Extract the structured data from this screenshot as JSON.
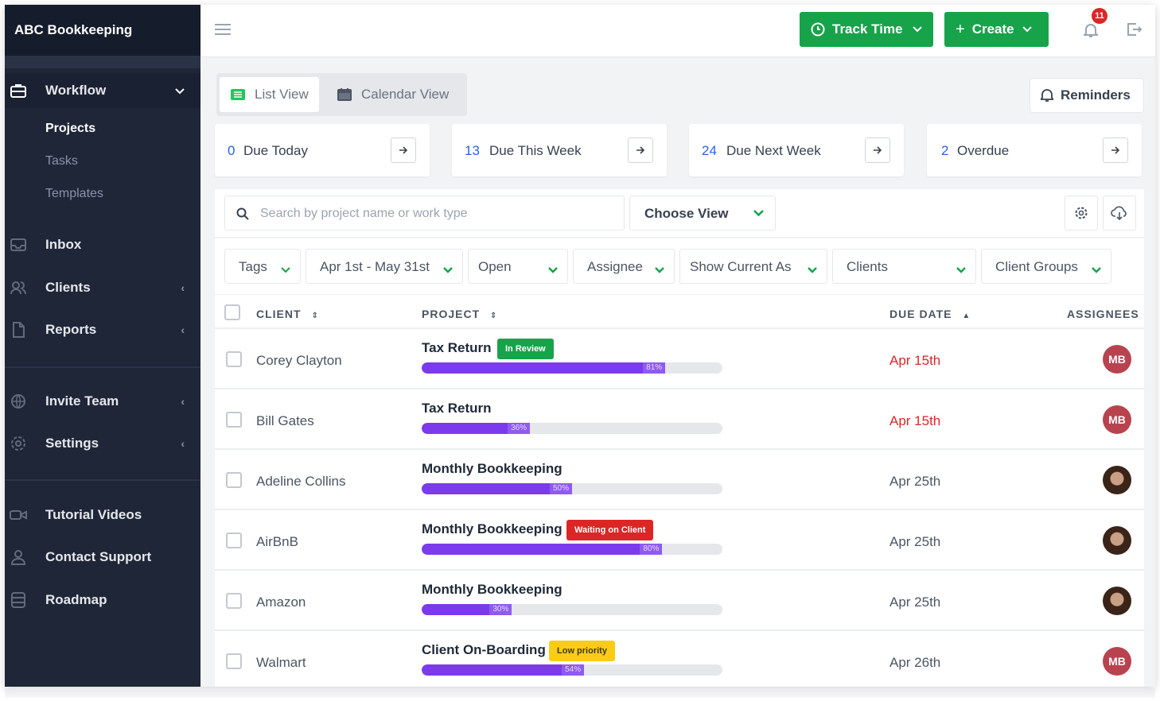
{
  "app": {
    "title": "ABC Bookkeeping"
  },
  "sidebar": {
    "workflow": "Workflow",
    "sub": [
      "Projects",
      "Tasks",
      "Templates"
    ],
    "items": [
      {
        "label": "Inbox",
        "icon": "inbox-icon"
      },
      {
        "label": "Clients",
        "icon": "users-icon"
      },
      {
        "label": "Reports",
        "icon": "document-icon"
      },
      {
        "label": "Invite Team",
        "icon": "globe-icon"
      },
      {
        "label": "Settings",
        "icon": "gear-icon"
      },
      {
        "label": "Tutorial Videos",
        "icon": "video-icon"
      },
      {
        "label": "Contact Support",
        "icon": "person-icon"
      },
      {
        "label": "Roadmap",
        "icon": "database-icon"
      }
    ]
  },
  "topbar": {
    "track_time": "Track Time",
    "create": "Create",
    "notifications": "11",
    "accent": "#16a34a"
  },
  "views": {
    "list": "List View",
    "calendar": "Calendar View"
  },
  "reminders": "Reminders",
  "summary": [
    {
      "count": "0",
      "label": "Due Today"
    },
    {
      "count": "13",
      "label": "Due This Week"
    },
    {
      "count": "24",
      "label": "Due Next Week"
    },
    {
      "count": "2",
      "label": "Overdue"
    }
  ],
  "search": {
    "placeholder": "Search by project name or work type"
  },
  "choose_view": "Choose View",
  "filters": [
    "Tags",
    "Apr 1st - May 31st",
    "Open",
    "Assignee",
    "Show Current As",
    "Clients",
    "Client Groups"
  ],
  "table": {
    "headers": {
      "client": "CLIENT",
      "project": "PROJECT",
      "due": "DUE DATE",
      "assignees": "ASSIGNEES"
    },
    "rows": [
      {
        "client": "Corey Clayton",
        "project": "Tax Return",
        "tag": "In Review",
        "tag_color": "#16a34a",
        "progress": 81,
        "progress_label": "81%",
        "due": "Apr 15th",
        "overdue": true,
        "assignee": "MB"
      },
      {
        "client": "Bill Gates",
        "project": "Tax Return",
        "tag": "",
        "progress": 36,
        "progress_label": "36%",
        "due": "Apr 15th",
        "overdue": true,
        "assignee": "MB"
      },
      {
        "client": "Adeline Collins",
        "project": "Monthly Bookkeeping",
        "tag": "",
        "progress": 50,
        "progress_label": "50%",
        "due": "Apr 25th",
        "overdue": false,
        "assignee": "photo"
      },
      {
        "client": "AirBnB",
        "project": "Monthly Bookkeeping",
        "tag": "Waiting on Client",
        "tag_color": "#dc2626",
        "progress": 80,
        "progress_label": "80%",
        "due": "Apr 25th",
        "overdue": false,
        "assignee": "photo"
      },
      {
        "client": "Amazon",
        "project": "Monthly Bookkeeping",
        "tag": "",
        "progress": 30,
        "progress_label": "30%",
        "due": "Apr 25th",
        "overdue": false,
        "assignee": "photo"
      },
      {
        "client": "Walmart",
        "project": "Client On-Boarding",
        "tag": "Low priority",
        "tag_color": "#facc15",
        "progress": 54,
        "progress_label": "54%",
        "due": "Apr 26th",
        "overdue": false,
        "assignee": "MB"
      }
    ]
  }
}
